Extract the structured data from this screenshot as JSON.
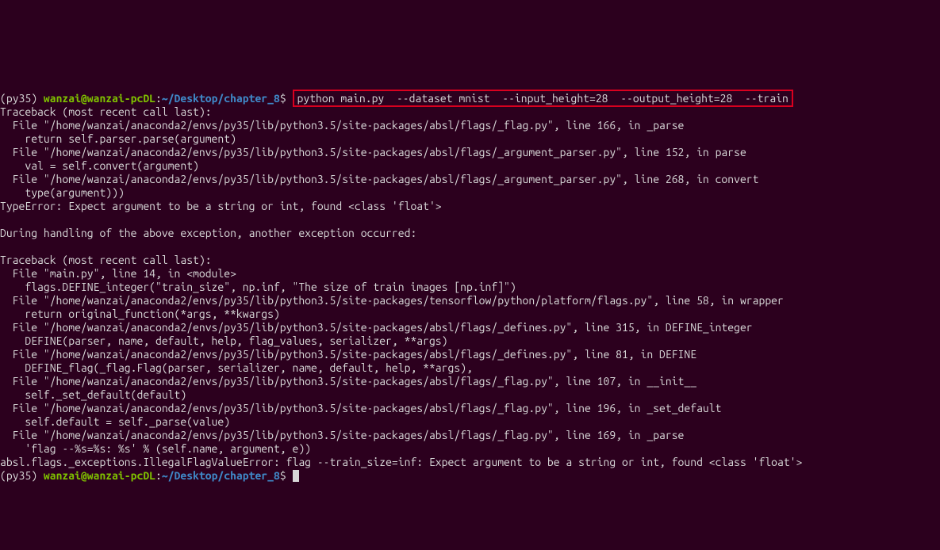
{
  "prompt1": {
    "env": "(py35) ",
    "user": "wanzai@wanzai-pcDL",
    "sep": ":",
    "path": "~/Desktop/chapter_8",
    "dollar": "$ ",
    "command": "python main.py  --dataset mnist  --input_height=28  --output_height=28  --train"
  },
  "traceback1": {
    "header": "Traceback (most recent call last):",
    "lines": [
      "  File \"/home/wanzai/anaconda2/envs/py35/lib/python3.5/site-packages/absl/flags/_flag.py\", line 166, in _parse",
      "    return self.parser.parse(argument)",
      "  File \"/home/wanzai/anaconda2/envs/py35/lib/python3.5/site-packages/absl/flags/_argument_parser.py\", line 152, in parse",
      "    val = self.convert(argument)",
      "  File \"/home/wanzai/anaconda2/envs/py35/lib/python3.5/site-packages/absl/flags/_argument_parser.py\", line 268, in convert",
      "    type(argument)))",
      "TypeError: Expect argument to be a string or int, found <class 'float'>"
    ]
  },
  "mid": "During handling of the above exception, another exception occurred:",
  "traceback2": {
    "header": "Traceback (most recent call last):",
    "lines": [
      "  File \"main.py\", line 14, in <module>",
      "    flags.DEFINE_integer(\"train_size\", np.inf, \"The size of train images [np.inf]\")",
      "  File \"/home/wanzai/anaconda2/envs/py35/lib/python3.5/site-packages/tensorflow/python/platform/flags.py\", line 58, in wrapper",
      "    return original_function(*args, **kwargs)",
      "  File \"/home/wanzai/anaconda2/envs/py35/lib/python3.5/site-packages/absl/flags/_defines.py\", line 315, in DEFINE_integer",
      "    DEFINE(parser, name, default, help, flag_values, serializer, **args)",
      "  File \"/home/wanzai/anaconda2/envs/py35/lib/python3.5/site-packages/absl/flags/_defines.py\", line 81, in DEFINE",
      "    DEFINE_flag(_flag.Flag(parser, serializer, name, default, help, **args),",
      "  File \"/home/wanzai/anaconda2/envs/py35/lib/python3.5/site-packages/absl/flags/_flag.py\", line 107, in __init__",
      "    self._set_default(default)",
      "  File \"/home/wanzai/anaconda2/envs/py35/lib/python3.5/site-packages/absl/flags/_flag.py\", line 196, in _set_default",
      "    self.default = self._parse(value)",
      "  File \"/home/wanzai/anaconda2/envs/py35/lib/python3.5/site-packages/absl/flags/_flag.py\", line 169, in _parse",
      "    'flag --%s=%s: %s' % (self.name, argument, e))",
      "absl.flags._exceptions.IllegalFlagValueError: flag --train_size=inf: Expect argument to be a string or int, found <class 'float'>"
    ]
  },
  "prompt2": {
    "env": "(py35) ",
    "user": "wanzai@wanzai-pcDL",
    "sep": ":",
    "path": "~/Desktop/chapter_8",
    "dollar": "$ "
  }
}
